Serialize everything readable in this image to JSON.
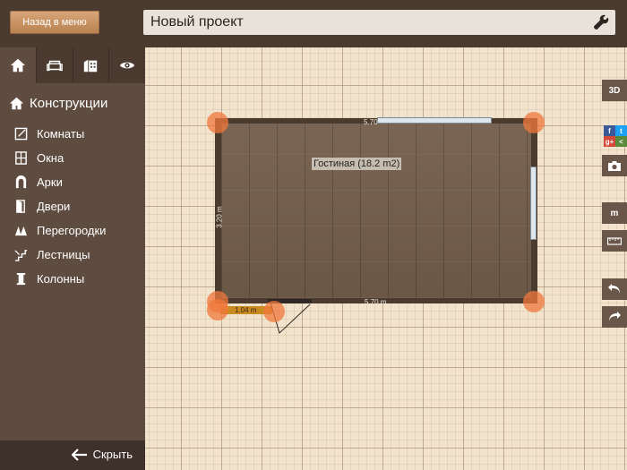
{
  "topbar": {
    "back_label": "Назад в меню",
    "project_title": "Новый проект"
  },
  "sidebar": {
    "tabs": [
      "home-icon",
      "sofa-icon",
      "building-icon",
      "eye-icon"
    ],
    "section_title": "Конструкции",
    "items": [
      {
        "label": "Комнаты",
        "icon": "room-icon"
      },
      {
        "label": "Окна",
        "icon": "window-icon"
      },
      {
        "label": "Арки",
        "icon": "arch-icon"
      },
      {
        "label": "Двери",
        "icon": "door-icon"
      },
      {
        "label": "Перегородки",
        "icon": "partition-icon"
      },
      {
        "label": "Лестницы",
        "icon": "stairs-icon"
      },
      {
        "label": "Колонны",
        "icon": "column-icon"
      }
    ],
    "hide_label": "Скрыть"
  },
  "plan": {
    "room_label": "Гостиная (18.2 m2)",
    "dim_top": "5.70",
    "dim_bottom": "5.70 m",
    "dim_left": "3.20 m",
    "door_dim": "1.04 m"
  },
  "rightbar": {
    "btn_3d": "3D",
    "btn_units": "m"
  }
}
